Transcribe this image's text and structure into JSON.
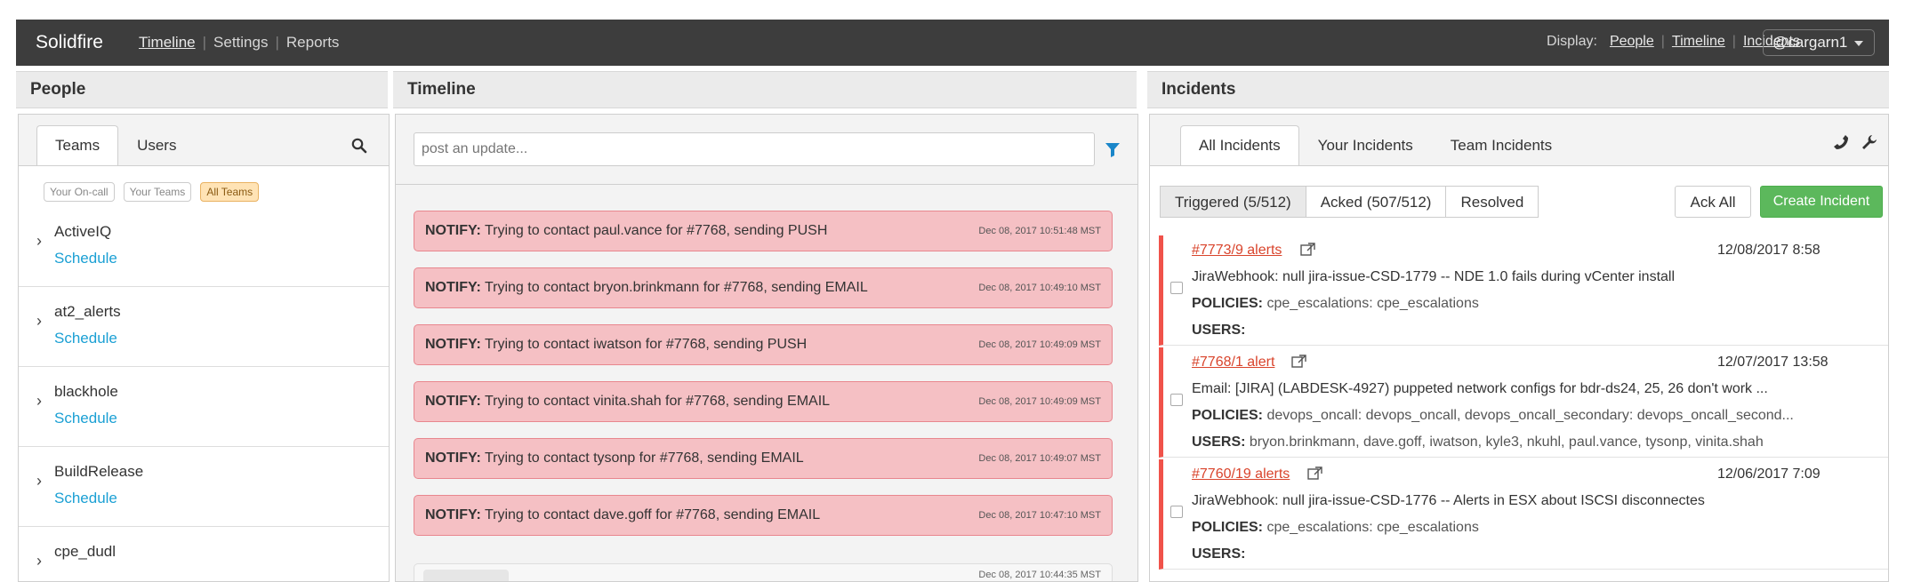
{
  "nav": {
    "brand": "Solidfire",
    "links": [
      "Timeline",
      "Settings",
      "Reports"
    ],
    "display_label": "Display:",
    "display_links": [
      "People",
      "Timeline",
      "Incidents"
    ],
    "user": "@cargarn1"
  },
  "sections": {
    "people": "People",
    "timeline": "Timeline",
    "incidents": "Incidents"
  },
  "people": {
    "tabs": [
      "Teams",
      "Users"
    ],
    "filters": [
      "Your On-call",
      "Your Teams",
      "All Teams"
    ],
    "teams": [
      {
        "name": "ActiveIQ",
        "link": "Schedule"
      },
      {
        "name": "at2_alerts",
        "link": "Schedule"
      },
      {
        "name": "blackhole",
        "link": "Schedule"
      },
      {
        "name": "BuildRelease",
        "link": "Schedule"
      },
      {
        "name": "cpe_dudl",
        "link": ""
      }
    ]
  },
  "timeline": {
    "placeholder": "post an update...",
    "events": [
      {
        "label": "NOTIFY:",
        "text": " Trying to contact paul.vance for #7768, sending PUSH",
        "ts": "Dec 08, 2017 10:51:48 MST"
      },
      {
        "label": "NOTIFY:",
        "text": " Trying to contact bryon.brinkmann for #7768, sending EMAIL",
        "ts": "Dec 08, 2017 10:49:10 MST"
      },
      {
        "label": "NOTIFY:",
        "text": " Trying to contact iwatson for #7768, sending PUSH",
        "ts": "Dec 08, 2017 10:49:09 MST"
      },
      {
        "label": "NOTIFY:",
        "text": " Trying to contact vinita.shah for #7768, sending EMAIL",
        "ts": "Dec 08, 2017 10:49:09 MST"
      },
      {
        "label": "NOTIFY:",
        "text": " Trying to contact tysonp for #7768, sending EMAIL",
        "ts": "Dec 08, 2017 10:49:07 MST"
      },
      {
        "label": "NOTIFY:",
        "text": " Trying to contact dave.goff for #7768, sending EMAIL",
        "ts": "Dec 08, 2017 10:47:10 MST"
      }
    ],
    "partial_ts": "Dec 08, 2017 10:44:35 MST"
  },
  "incidents": {
    "tabs": [
      "All Incidents",
      "Your Incidents",
      "Team Incidents"
    ],
    "states": [
      "Triggered (5/512)",
      "Acked (507/512)",
      "Resolved"
    ],
    "ack_all": "Ack All",
    "create": "Create Incident",
    "policies_label": "POLICIES:",
    "users_label": "USERS:",
    "list": [
      {
        "id": "#7773/9 alerts",
        "date": "12/08/2017 8:58",
        "title": "JiraWebhook: null jira-issue-CSD-1779 -- NDE 1.0 fails during vCenter install",
        "policies": " cpe_escalations: cpe_escalations",
        "users": ""
      },
      {
        "id": "#7768/1 alert",
        "date": "12/07/2017 13:58",
        "title": "Email: [JIRA] (LABDESK-4927) puppeted network configs for bdr-ds24, 25, 26 don't work ...",
        "policies": " devops_oncall: devops_oncall, devops_oncall_secondary: devops_oncall_second...",
        "users": " bryon.brinkmann, dave.goff, iwatson, kyle3, nkuhl, paul.vance, tysonp, vinita.shah"
      },
      {
        "id": "#7760/19 alerts",
        "date": "12/06/2017 7:09",
        "title": "JiraWebhook: null jira-issue-CSD-1776 -- Alerts in ESX about ISCSI disconnectes",
        "policies": " cpe_escalations: cpe_escalations",
        "users": ""
      }
    ]
  },
  "colors": {
    "navbar": "#3d3d3d",
    "notify_bg": "#f5c0c4",
    "incident_accent": "#f0524a",
    "link": "#1ba0d4",
    "create": "#5cb85c"
  }
}
